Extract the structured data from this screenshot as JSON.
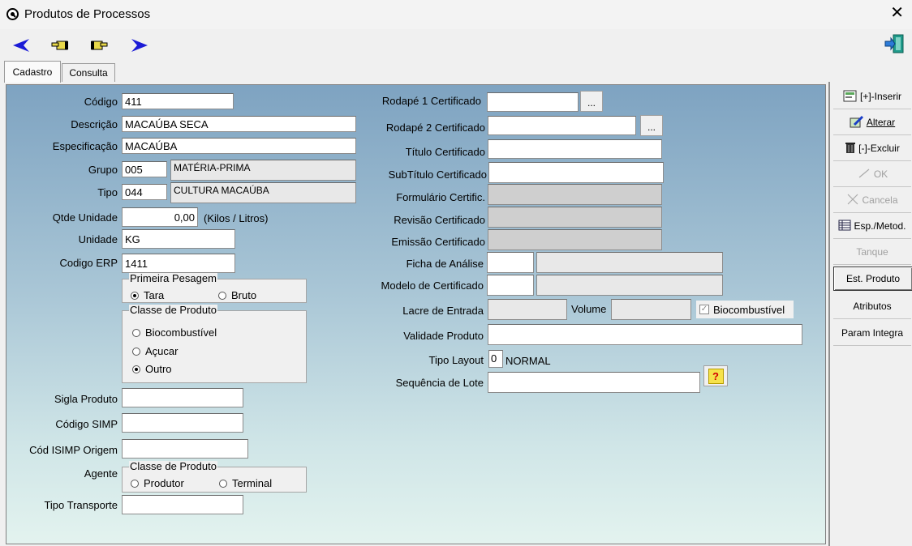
{
  "window": {
    "title": "Produtos de Processos"
  },
  "tabs": [
    {
      "label": "Cadastro"
    },
    {
      "label": "Consulta"
    }
  ],
  "left": {
    "codigo": {
      "label": "Código",
      "value": "411"
    },
    "descricao": {
      "label": "Descrição",
      "value": "MACAÚBA SECA"
    },
    "especificacao": {
      "label": "Especificação",
      "value": "MACAÚBA"
    },
    "grupo": {
      "label": "Grupo",
      "code": "005",
      "name": "MATÉRIA-PRIMA"
    },
    "tipo": {
      "label": "Tipo",
      "code": "044",
      "name": "CULTURA MACAÚBA"
    },
    "qtde": {
      "label": "Qtde Unidade",
      "value": "0,00",
      "unit": "(Kilos / Litros)"
    },
    "unidade": {
      "label": "Unidade",
      "value": "KG"
    },
    "codigo_erp": {
      "label": "Codigo ERP",
      "value": "1411"
    },
    "primeira_pesagem": {
      "title": "Primeira Pesagem",
      "options": [
        "Tara",
        "Bruto"
      ],
      "selected": "Tara"
    },
    "classe_produto": {
      "title": "Classe de Produto",
      "options": [
        "Biocombustível",
        "Açucar",
        "Outro"
      ],
      "selected": "Outro"
    },
    "sigla": {
      "label": "Sigla Produto",
      "value": ""
    },
    "codigo_simp": {
      "label": "Código SIMP",
      "value": ""
    },
    "cod_isimp": {
      "label": "Cód ISIMP  Origem",
      "value": ""
    },
    "agente": {
      "label": "Agente",
      "group_title": "Classe de Produto",
      "options": [
        "Produtor",
        "Terminal"
      ],
      "selected": ""
    },
    "tipo_transporte": {
      "label": "Tipo Transporte",
      "value": ""
    }
  },
  "right": {
    "rodape1": {
      "label": "Rodapé 1 Certificado",
      "value": "",
      "button": "..."
    },
    "rodape2": {
      "label": "Rodapé 2 Certificado",
      "value": "",
      "button": "..."
    },
    "titulo": {
      "label": "Título Certificado",
      "value": ""
    },
    "subtitulo": {
      "label": "SubTítulo Certificado",
      "value": ""
    },
    "formulario": {
      "label": "Formulário Certific.",
      "value": ""
    },
    "revisao": {
      "label": "Revisão Certificado",
      "value": ""
    },
    "emissao": {
      "label": "Emissão Certificado",
      "value": ""
    },
    "ficha": {
      "label": "Ficha de Análise",
      "code": "",
      "name": ""
    },
    "modelo": {
      "label": "Modelo de Certificado",
      "code": "",
      "name": ""
    },
    "lacre": {
      "label": "Lacre de Entrada",
      "value": ""
    },
    "volume": {
      "label": "Volume",
      "value": ""
    },
    "biocombustivel": {
      "label": "Biocombustível",
      "checked": true
    },
    "validade": {
      "label": "Validade Produto",
      "value": ""
    },
    "tipo_layout": {
      "label": "Tipo Layout",
      "value": "0",
      "text": "NORMAL"
    },
    "sequencia": {
      "label": "Sequência de Lote",
      "value": "",
      "button": "?"
    }
  },
  "sidebar": {
    "inserir": "[+]-Inserir",
    "alterar": "Alterar",
    "excluir": "[-]-Excluir",
    "ok": "OK",
    "cancela": "Cancela",
    "esp_metod": "Esp./Metod.",
    "tanque": "Tanque",
    "est_produto": "Est. Produto",
    "atributos": "Atributos",
    "param_integra": "Param Integra"
  }
}
